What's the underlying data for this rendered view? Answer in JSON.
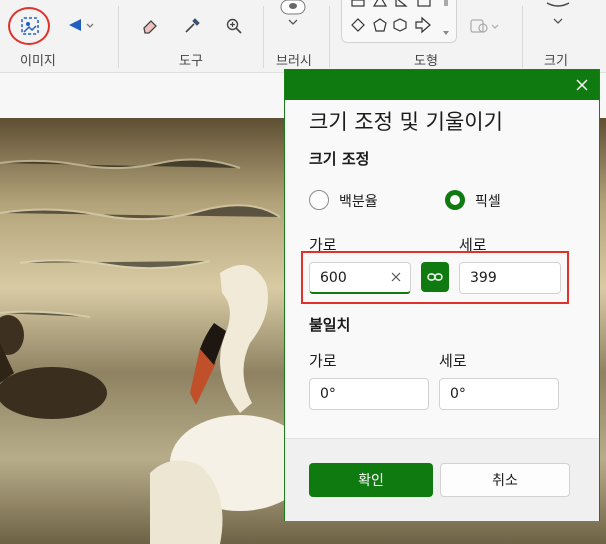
{
  "ribbon": {
    "groups": {
      "image": "이미지",
      "tools": "도구",
      "brushes": "브러시",
      "shapes": "도형",
      "size": "크기"
    }
  },
  "dialog": {
    "title": "크기 조정 및 기울이기",
    "resize_section": "크기 조정",
    "radio_percent": "백분율",
    "radio_pixel": "픽셀",
    "selected_unit": "픽셀",
    "width_label": "가로",
    "height_label": "세로",
    "width_value": "600",
    "height_value": "399",
    "skew_section": "불일치",
    "skew_h_label": "가로",
    "skew_v_label": "세로",
    "skew_h_value": "0°",
    "skew_v_value": "0°",
    "ok_label": "확인",
    "cancel_label": "취소"
  },
  "colors": {
    "accent": "#0f7a0f",
    "highlight": "#e0322a"
  }
}
